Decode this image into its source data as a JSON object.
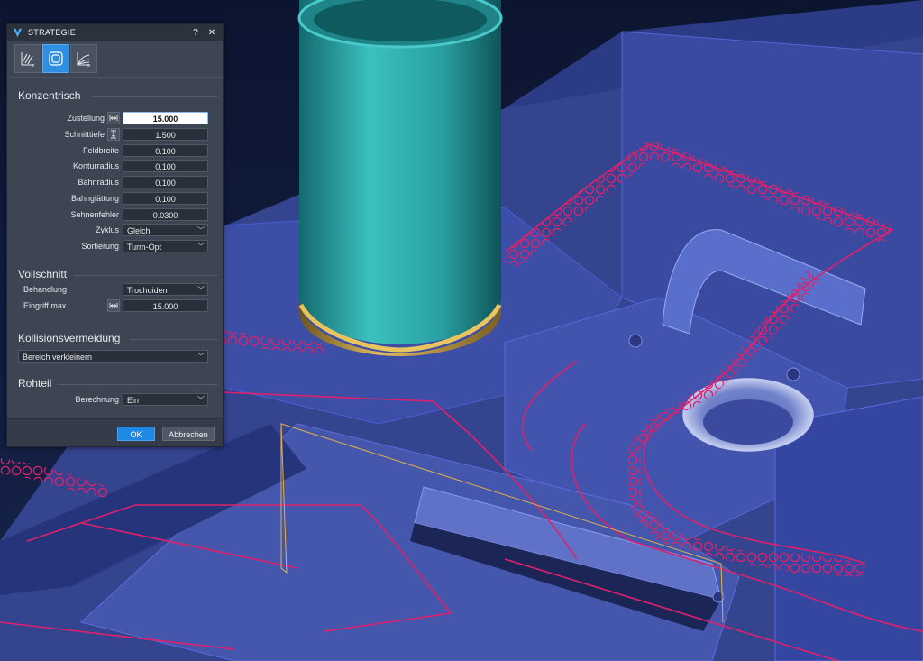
{
  "dialog": {
    "title": "STRATEGIE",
    "help": "?",
    "close": "✕",
    "tabs": [
      {
        "icon": "strategy-parallel-icon"
      },
      {
        "icon": "strategy-concentric-icon"
      },
      {
        "icon": "strategy-radial-icon"
      }
    ],
    "sections": {
      "konzentrisch": "Konzentrisch",
      "vollschnitt": "Vollschnitt",
      "kollision": "Kollisionsvermeidung",
      "rohteil": "Rohteil"
    },
    "fields": {
      "zustellung": {
        "label": "Zustellung",
        "value": "15.000"
      },
      "schnitttiefe": {
        "label": "Schnitttiefe",
        "value": "1.500"
      },
      "feldbreite": {
        "label": "Feldbreite",
        "value": "0.100"
      },
      "konturradius": {
        "label": "Konturradius",
        "value": "0.100"
      },
      "bahnradius": {
        "label": "Bahnradius",
        "value": "0.100"
      },
      "bahnglaettung": {
        "label": "Bahnglättung",
        "value": "0.100"
      },
      "sehnenfehler": {
        "label": "Sehnenfehler",
        "value": "0.0300"
      },
      "zyklus": {
        "label": "Zyklus",
        "value": "Gleich"
      },
      "sortierung": {
        "label": "Sortierung",
        "value": "Turm-Opt"
      },
      "behandlung": {
        "label": "Behandlung",
        "value": "Trochoiden"
      },
      "eingriff": {
        "label": "Eingriff max.",
        "value": "15.000"
      },
      "kollision_mode": {
        "value": "Bereich verkleinern"
      },
      "berechnung": {
        "label": "Berechnung",
        "value": "Ein"
      }
    },
    "buttons": {
      "ok": "OK",
      "cancel": "Abbrechen"
    }
  },
  "colors": {
    "accent": "#1e88e5",
    "toolpath": "#e0206c",
    "model": "#3f4f9e",
    "tool": "#2ea7a8",
    "holder_ring": "#c9a34a"
  }
}
